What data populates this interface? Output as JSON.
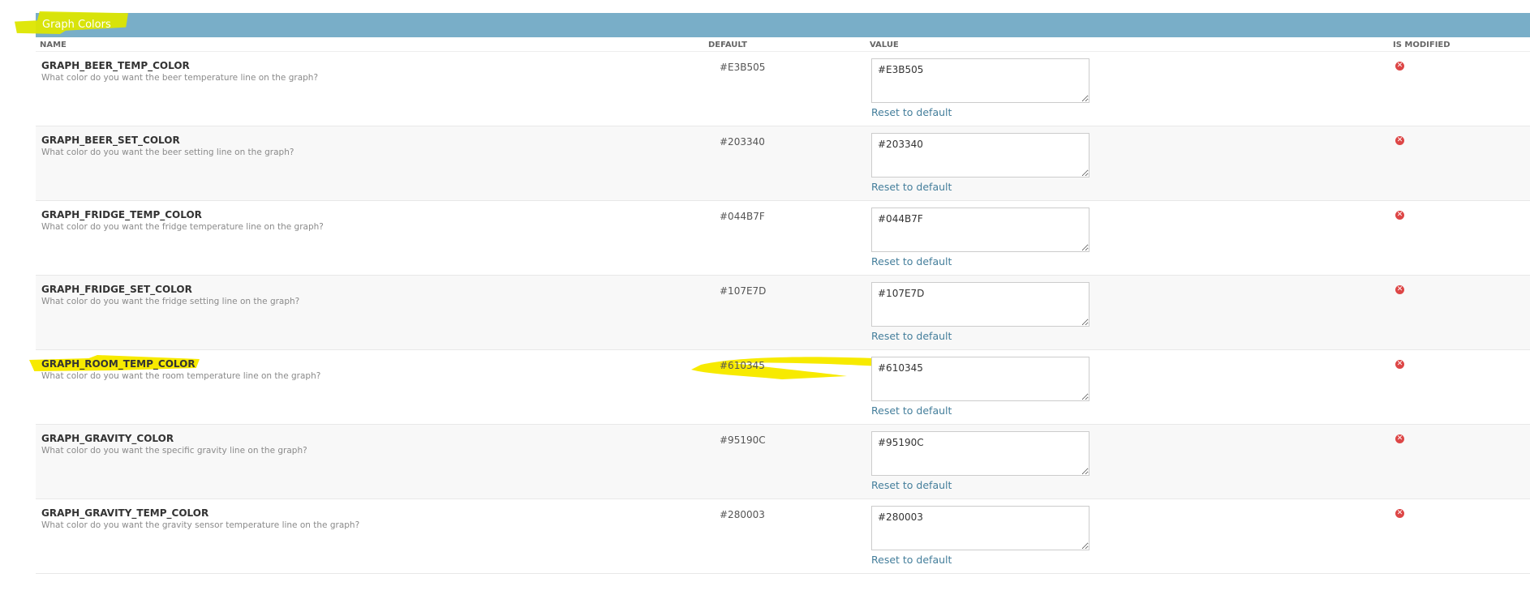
{
  "section": {
    "title": "Graph Colors"
  },
  "columns": {
    "name": "NAME",
    "default": "DEFAULT",
    "value": "VALUE",
    "is_modified": "IS MODIFIED"
  },
  "reset_label": "Reset to default",
  "highlight_color": "#f7ea00",
  "accent_color": "#79aec8",
  "link_color": "#447e9b",
  "modified_icon_color": "#dd4646",
  "rows": [
    {
      "name": "GRAPH_BEER_TEMP_COLOR",
      "description": "What color do you want the beer temperature line on the graph?",
      "default": "#E3B505",
      "value": "#E3B505",
      "reset": "Reset to default",
      "modified_icon": "x-circle-icon"
    },
    {
      "name": "GRAPH_BEER_SET_COLOR",
      "description": "What color do you want the beer setting line on the graph?",
      "default": "#203340",
      "value": "#203340",
      "reset": "Reset to default",
      "modified_icon": "x-circle-icon"
    },
    {
      "name": "GRAPH_FRIDGE_TEMP_COLOR",
      "description": "What color do you want the fridge temperature line on the graph?",
      "default": "#044B7F",
      "value": "#044B7F",
      "reset": "Reset to default",
      "modified_icon": "x-circle-icon"
    },
    {
      "name": "GRAPH_FRIDGE_SET_COLOR",
      "description": "What color do you want the fridge setting line on the graph?",
      "default": "#107E7D",
      "value": "#107E7D",
      "reset": "Reset to default",
      "modified_icon": "x-circle-icon"
    },
    {
      "name": "GRAPH_ROOM_TEMP_COLOR",
      "description": "What color do you want the room temperature line on the graph?",
      "default": "#610345",
      "value": "#610345",
      "reset": "Reset to default",
      "modified_icon": "x-circle-icon"
    },
    {
      "name": "GRAPH_GRAVITY_COLOR",
      "description": "What color do you want the specific gravity line on the graph?",
      "default": "#95190C",
      "value": "#95190C",
      "reset": "Reset to default",
      "modified_icon": "x-circle-icon"
    },
    {
      "name": "GRAPH_GRAVITY_TEMP_COLOR",
      "description": "What color do you want the gravity sensor temperature line on the graph?",
      "default": "#280003",
      "value": "#280003",
      "reset": "Reset to default",
      "modified_icon": "x-circle-icon"
    }
  ]
}
